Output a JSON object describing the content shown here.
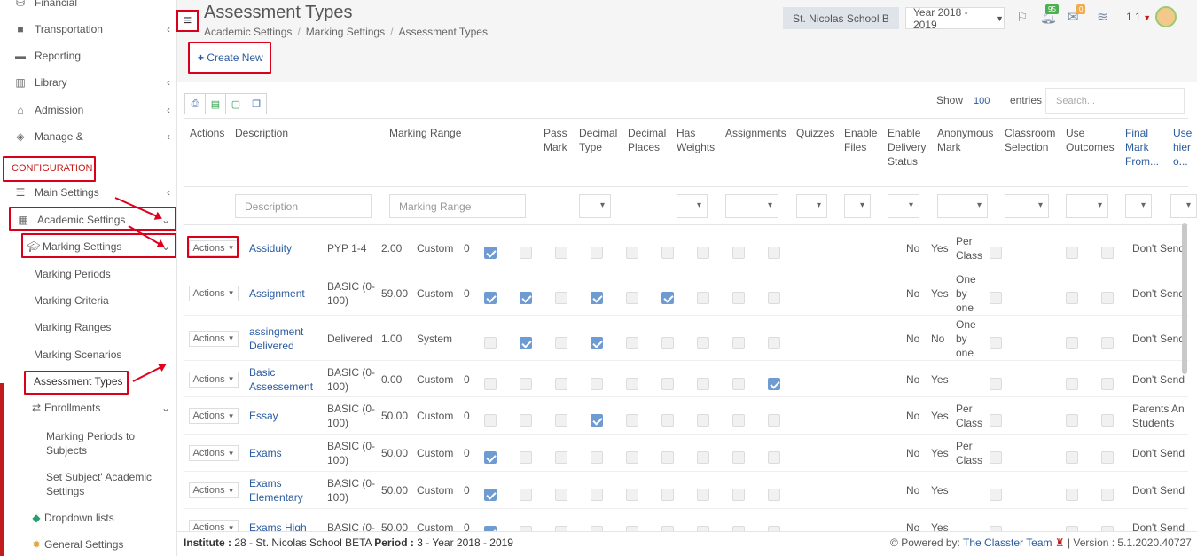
{
  "sidebar": {
    "items": [
      {
        "label": "Financial",
        "icon": "coins-icon"
      },
      {
        "label": "Transportation",
        "icon": "bus-icon"
      },
      {
        "label": "Reporting",
        "icon": "printer-icon"
      },
      {
        "label": "Library",
        "icon": "books-icon"
      },
      {
        "label": "Admission",
        "icon": "bank-icon"
      },
      {
        "label": "Manage &",
        "icon": "cube-icon"
      }
    ],
    "config_label": "CONFIGURATION",
    "main_settings": "Main Settings",
    "academic_settings": "Academic Settings",
    "marking_settings": "Marking Settings",
    "subs": [
      "Marking Periods",
      "Marking Criteria",
      "Marking Ranges",
      "Marking Scenarios",
      "Assessment Types"
    ],
    "enrollments": "Enrollments",
    "enroll_sub1a": "Marking Periods to",
    "enroll_sub1b": "Subjects",
    "enroll_sub2a": "Set Subject' Academic",
    "enroll_sub2b": "Settings",
    "dropdown_lists": "Dropdown lists",
    "general_settings": "General Settings"
  },
  "header": {
    "title": "Assessment Types",
    "breadcrumb": [
      "Academic Settings",
      "Marking Settings",
      "Assessment Types"
    ],
    "school": "St. Nicolas School B",
    "year": "Year 2018 - 2019",
    "notif_count": "95",
    "mail_count": "0",
    "user_label": "1 1"
  },
  "toolbar": {
    "create_label": "Create New",
    "show_label": "Show",
    "show_value": "100",
    "entries_label": "entries",
    "search_placeholder": "Search..."
  },
  "table": {
    "headers": {
      "actions": "Actions",
      "description": "Description",
      "range": "Marking Range",
      "pass1": "Pass",
      "pass2": "Mark",
      "dt1": "Decimal",
      "dt2": "Type",
      "dp1": "Decimal",
      "dp2": "Places",
      "hw1": "Has",
      "hw2": "Weights",
      "assign": "Assignments",
      "quiz": "Quizzes",
      "ef1": "Enable",
      "ef2": "Files",
      "eds1": "Enable",
      "eds2": "Delivery",
      "eds3": "Status",
      "am1": "Anonymous",
      "am2": "Mark",
      "cs1": "Classroom",
      "cs2": "Selection",
      "uo1": "Use",
      "uo2": "Outcomes",
      "fm1": "Final",
      "fm2": "Mark",
      "fm3": "From...",
      "uh1": "Use",
      "uh2": "hier",
      "uh3": "o..."
    },
    "filter": {
      "desc_placeholder": "Description",
      "range_placeholder": "Marking Range"
    },
    "actions_label": "Actions",
    "rows": [
      {
        "desc": [
          "Assiduity"
        ],
        "range": [
          "PYP 1-4"
        ],
        "pass": "2.00",
        "type": "Custom",
        "places": "0",
        "checks": [
          1,
          0,
          0,
          0,
          0,
          0,
          0,
          0,
          0,
          0,
          0,
          0
        ],
        "c1": "No",
        "c2": "Yes",
        "c3": [
          "Per",
          "Class"
        ],
        "last": [
          "Don't Send"
        ]
      },
      {
        "desc": [
          "Assignment"
        ],
        "range": [
          "BASIC (0-",
          "100)"
        ],
        "pass": "59.00",
        "type": "Custom",
        "places": "0",
        "checks": [
          1,
          1,
          0,
          1,
          0,
          1,
          0,
          0,
          0,
          0,
          0,
          0
        ],
        "c1": "No",
        "c2": "Yes",
        "c3": [
          "One",
          "by",
          "one"
        ],
        "last": [
          "Don't Send"
        ]
      },
      {
        "desc": [
          "assingment",
          "Delivered"
        ],
        "range": [
          "Delivered"
        ],
        "pass": "1.00",
        "type": "System",
        "places": "",
        "checks": [
          0,
          1,
          0,
          1,
          0,
          0,
          0,
          0,
          0,
          0,
          0,
          0
        ],
        "c1": "No",
        "c2": "No",
        "c3": [
          "One",
          "by",
          "one"
        ],
        "last": [
          "Don't Send"
        ]
      },
      {
        "desc": [
          "Basic",
          "Assessement"
        ],
        "range": [
          "BASIC (0-",
          "100)"
        ],
        "pass": "0.00",
        "type": "Custom",
        "places": "0",
        "checks": [
          0,
          0,
          0,
          0,
          0,
          0,
          0,
          0,
          1,
          0,
          0,
          0
        ],
        "c1": "No",
        "c2": "Yes",
        "c3": [],
        "last": [
          "Don't Send"
        ]
      },
      {
        "desc": [
          "Essay"
        ],
        "range": [
          "BASIC (0-",
          "100)"
        ],
        "pass": "50.00",
        "type": "Custom",
        "places": "0",
        "checks": [
          0,
          0,
          0,
          1,
          0,
          0,
          0,
          0,
          0,
          0,
          0,
          0
        ],
        "c1": "No",
        "c2": "Yes",
        "c3": [
          "Per",
          "Class"
        ],
        "last": [
          "Parents An",
          "Students"
        ]
      },
      {
        "desc": [
          "Exams"
        ],
        "range": [
          "BASIC (0-",
          "100)"
        ],
        "pass": "50.00",
        "type": "Custom",
        "places": "0",
        "checks": [
          1,
          0,
          0,
          0,
          0,
          0,
          0,
          0,
          0,
          0,
          0,
          0
        ],
        "c1": "No",
        "c2": "Yes",
        "c3": [
          "Per",
          "Class"
        ],
        "last": [
          "Don't Send"
        ]
      },
      {
        "desc": [
          "Exams",
          "Elementary"
        ],
        "range": [
          "BASIC (0-",
          "100)"
        ],
        "pass": "50.00",
        "type": "Custom",
        "places": "0",
        "checks": [
          1,
          0,
          0,
          0,
          0,
          0,
          0,
          0,
          0,
          0,
          0,
          0
        ],
        "c1": "No",
        "c2": "Yes",
        "c3": [],
        "last": [
          "Don't Send"
        ]
      },
      {
        "desc": [
          "Exams High"
        ],
        "range": [
          "BASIC (0-"
        ],
        "pass": "50.00",
        "type": "Custom",
        "places": "0",
        "checks": [
          1,
          0,
          0,
          0,
          0,
          0,
          0,
          0,
          0,
          0,
          0,
          0
        ],
        "c1": "No",
        "c2": "Yes",
        "c3": [],
        "last": [
          "Don't Send"
        ]
      }
    ]
  },
  "footer": {
    "institute_label": "Institute :",
    "institute": "28 - St. Nicolas School BETA",
    "period_label": "Period :",
    "period": "3 - Year 2018 - 2019",
    "powered": "Powered by:",
    "team": "The Classter Team",
    "version": "| Version : 5.1.2020.40727"
  },
  "colors": {
    "accent": "#2a5b9f",
    "highlight": "#d9001b",
    "check": "#6e9bd1"
  }
}
